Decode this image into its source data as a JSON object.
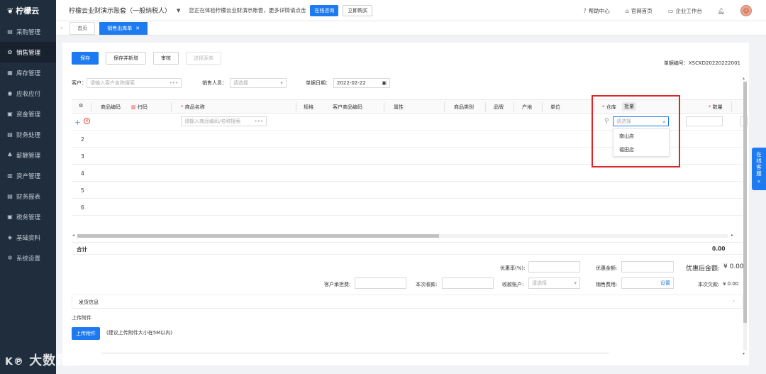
{
  "sidebar": {
    "logo": "柠檬云",
    "items": [
      {
        "label": "采购管理",
        "icon": "cart-icon",
        "active": false
      },
      {
        "label": "销售管理",
        "icon": "sale-icon",
        "active": true
      },
      {
        "label": "库存管理",
        "icon": "inventory-icon",
        "active": false
      },
      {
        "label": "应收应付",
        "icon": "receivable-icon",
        "active": false
      },
      {
        "label": "资金管理",
        "icon": "fund-icon",
        "active": false
      },
      {
        "label": "财务处理",
        "icon": "finance-icon",
        "active": false
      },
      {
        "label": "薪酬管理",
        "icon": "salary-icon",
        "active": false
      },
      {
        "label": "资产管理",
        "icon": "asset-icon",
        "active": false
      },
      {
        "label": "财务报表",
        "icon": "report-icon",
        "active": false
      },
      {
        "label": "税务管理",
        "icon": "tax-icon",
        "active": false
      },
      {
        "label": "基础资料",
        "icon": "basic-data-icon",
        "active": false
      },
      {
        "label": "系统设置",
        "icon": "settings-icon",
        "active": false
      }
    ]
  },
  "header": {
    "account": "柠檬云业财演示账套（一般纳税人）",
    "notice": "您正在体验柠檬云业财演示账套，更多详情请点击",
    "consult_btn": "在线咨询",
    "buy_btn": "立即购买",
    "help": "帮助中心",
    "website": "官网首页",
    "workbench": "企业工作台"
  },
  "tabs": {
    "home": "首页",
    "active": "销售出库单"
  },
  "toolbar": {
    "save": "保存",
    "save_new": "保存并新增",
    "audit": "审核",
    "select_source": "选择源单"
  },
  "doc": {
    "number_label": "单据编号：",
    "number": "XSCKD20220222001"
  },
  "form": {
    "customer_label": "客户：",
    "customer_placeholder": "请输入客户名称搜索",
    "salesperson_label": "销售人员：",
    "salesperson_placeholder": "请选择",
    "date_label": "单据日期：",
    "date_value": "2022-02-22"
  },
  "table": {
    "headers": {
      "product_code": "商品编码",
      "scan": "扫码",
      "product_name": "商品名称",
      "spec": "规格",
      "customer_code": "客户商品编码",
      "attribute": "属性",
      "category": "商品类别",
      "brand": "品牌",
      "origin": "产地",
      "unit": "单位",
      "warehouse": "仓库",
      "batch": "批量",
      "quantity": "数量"
    },
    "product_placeholder": "请输入商品编码/名称搜索",
    "warehouse_placeholder": "请选择",
    "rows": [
      "2",
      "3",
      "4",
      "5",
      "6"
    ],
    "total_label": "合计",
    "total_value": "0.00"
  },
  "warehouse_dropdown": {
    "options": [
      "南山店",
      "福田店"
    ]
  },
  "amounts": {
    "discount_rate_label": "优惠率(%):",
    "discount_amount_label": "优惠金额:",
    "after_discount_label": "优惠后金额:",
    "after_discount_value": "¥ 0.00",
    "customer_cost_label": "客户承担费:",
    "receipt_label": "本次收款:",
    "account_label": "收款账户:",
    "account_placeholder": "请选择",
    "sales_fee_label": "销售费用:",
    "sales_fee_setting": "设置",
    "arrears_label": "本次欠款:",
    "arrears_value": "¥ 0.00"
  },
  "shipping": {
    "label": "发货信息"
  },
  "attachment": {
    "label": "上传附件",
    "button": "上传附件",
    "hint": "(建议上传附件大小在5M以内)"
  },
  "service": {
    "chars": [
      "在",
      "线",
      "客",
      "服"
    ]
  },
  "watermark": "大数跨境"
}
